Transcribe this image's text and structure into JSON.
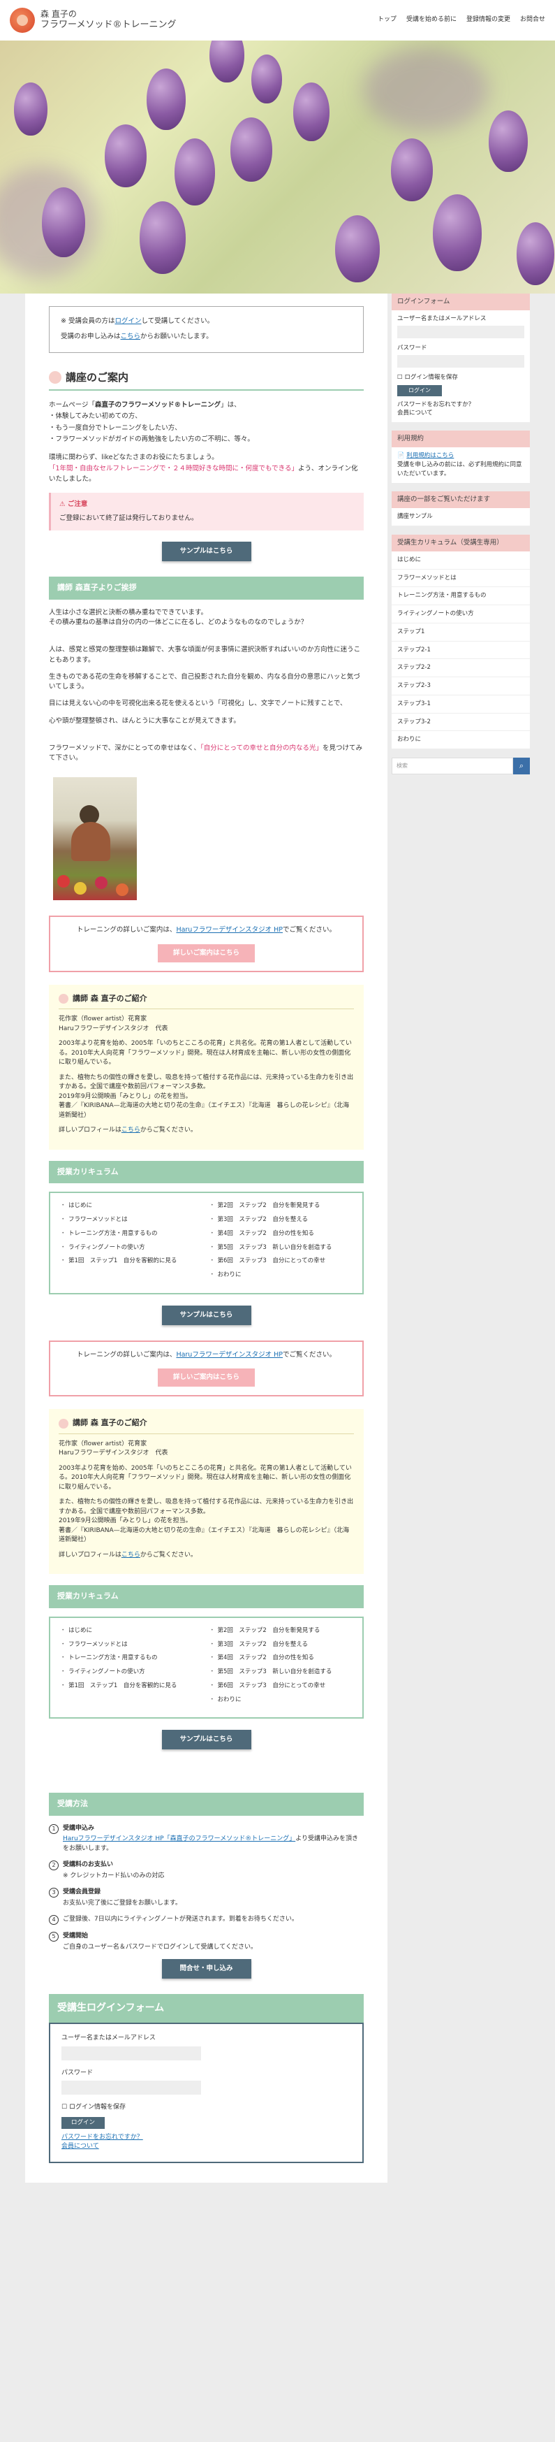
{
  "header": {
    "logo_line1": "森 直子の",
    "logo_line2": "フラワーメソッド®トレーニング",
    "nav": [
      "トップ",
      "受講を始める前に",
      "登録情報の変更",
      "お問合せ"
    ]
  },
  "notice": {
    "line1_pre": "※ 受講会員の方は",
    "line1_link": "ログイン",
    "line1_post": "して受講してください。",
    "line2_pre": "受講のお申し込みは",
    "line2_link": "こちら",
    "line2_post": "からお願いいたします。"
  },
  "intro": {
    "title": "講座のご案内",
    "p1_pre": "ホームページ「",
    "p1_bold": "森直子のフラワーメソッド®トレーニング",
    "p1_post": "」は、",
    "p1_lines": [
      "・体験してみたい初めての方、",
      "・もう一度自分でトレーニングをしたい方、",
      "・フラワーメソッドがガイドの再勉強をしたい方のご不明に、等々。"
    ],
    "p2": "環境に関わらず、likeどなたさまのお役にたちましょう。",
    "p2_pink": "「1年間・自由なセルフトレーニングで・２４時間好きな時間に・何度でもできる」",
    "p2_post": "よう、オンライン化いたしました。"
  },
  "alert": {
    "title": "ご注意",
    "text": "ご登録において終了証は発行しておりません。"
  },
  "sample_button": "サンプルはこちら",
  "greeting": {
    "band": "講師 森直子よりご挨拶",
    "p1": [
      "人生は小さな選択と決断の積み重ねでできています。",
      "その積み重ねの基準は自分の内の一体どこに在るし、どのようなものなのでしょうか？"
    ],
    "p2": [
      "人は、感覚と感覚の整理整頓は難解で、大事な頃面が何ま事情に選択決断すればいいのか方向性に迷うこともあります。"
    ],
    "p3": [
      "生きものである花の生命を移解することで、自己投影された自分を観め、内なる自分の意思にハッと気づいてしまう。"
    ],
    "p4": [
      "目には見えない心の中を可視化出来る花を使えるという「可視化」し、文字でノートに残すことで、",
      "心や頭が整理整頓され、ほんとうに大事なことが見えてきます。"
    ],
    "p5_pre": "フラワーメソッドで、深かにとっての幸せはなく、",
    "p5_pink": "「自分にとっての幸せと自分の内なる光」",
    "p5_post": "を見つけてみて下さい。"
  },
  "studio": {
    "pre": "トレーニングの詳しいご案内は、",
    "link": "Haruフラワーデザインスタジオ HP",
    "post": "でご覧ください。",
    "button": "詳しいご案内はこちら"
  },
  "lecturer": {
    "title": "講師 森 直子のご紹介",
    "role1": "花作家（flower artist）花育家",
    "role2": "Haruフラワーデザインスタジオ　代表",
    "p1": "2003年より花育を始め、2005年「いのちとこころの花育」と共名化。花育の第1人者として活動している。2010年大人向花育「フラワーメソッド」開発。現在は人材育成を主軸に、新しい形の女性の側面化に取り組んでいる。",
    "p2": "また、植物たちの個性の輝きを愛し、吸息を持って植付する花作品には、元来持っている生命力を引き出すかある。全国で講座や数前回パフォーマンス多数。",
    "p3": "2019年9月公開映画「みとりし」の花を担当。",
    "p4": "著書／『KIRIBANA—北海道の大地と切り花の生命』（エイチエス）『北海道　暮らしの花レシピ』（北海道新聞社）",
    "more_pre": "詳しいプロフィールは",
    "more_link": "こちら",
    "more_post": "からご覧ください。"
  },
  "curriculum": {
    "band": "授業カリキュラム",
    "left": [
      "はじめに",
      "フラワーメソッドとは",
      "トレーニング方法・用意するもの",
      "ライティングノートの使い方",
      "第1回　ステップ1　自分を客観的に見る"
    ],
    "right": [
      "第2回　ステップ2　自分を斬発見する",
      "第3回　ステップ2　自分を整える",
      "第4回　ステップ2　自分の性を知る",
      "第5回　ステップ3　新しい自分を創造する",
      "第6回　ステップ3　自分にとっての幸せ",
      "おわりに"
    ]
  },
  "method": {
    "band": "受講方法",
    "steps": [
      {
        "n": "1",
        "title": "受講申込み",
        "link": "Haruフラワーデザインスタジオ HP「森直子のフラワーメソッド®トレーニング」",
        "text": "より受講申込みを頂きをお願いします。"
      },
      {
        "n": "2",
        "title": "受講料のお支払い",
        "text": "※ クレジットカード払いのみの対応"
      },
      {
        "n": "3",
        "title": "受講会員登録",
        "text": "お支払い完了後にご登録をお願いします。"
      },
      {
        "n": "4",
        "title": "",
        "text": "ご登録後、7日以内にライティングノートが発送されます。到着をお待ちください。"
      },
      {
        "n": "5",
        "title": "受講開始",
        "text": "ご自身のユーザー名＆パスワードでログインして受講してください。"
      }
    ],
    "button": "問合せ・申し込み"
  },
  "login_form": {
    "title": "受講生ログインフォーム",
    "user_label": "ユーザー名またはメールアドレス",
    "pass_label": "パスワード",
    "remember": "ログイン情報を保存",
    "button": "ログイン",
    "forgot": "パスワードをお忘れですか？",
    "register": "会員について"
  },
  "sidebar": {
    "login": {
      "title": "ログインフォーム",
      "user_label": "ユーザー名またはメールアドレス",
      "pass_label": "パスワード",
      "remember": "ログイン情報を保存",
      "button": "ログイン",
      "forgot": "パスワードをお忘れですか？",
      "register": "会員について"
    },
    "terms": {
      "title": "利用規約",
      "link": "利用規約はこちら",
      "text": "受講を申し込みの前には、必ず利用規約に同意いただいています。"
    },
    "sample": {
      "title": "講座の一部をご覧いただけます",
      "item": "講座サンプル"
    },
    "curriculum": {
      "title": "受講生カリキュラム（受講生専用）",
      "items": [
        "はじめに",
        "フラワーメソッドとは",
        "トレーニング方法・用意するもの",
        "ライティングノートの使い方",
        "ステップ1",
        "ステップ2-1",
        "ステップ2-2",
        "ステップ2-3",
        "ステップ3-1",
        "ステップ3-2",
        "おわりに"
      ]
    },
    "search_placeholder": "検索"
  }
}
